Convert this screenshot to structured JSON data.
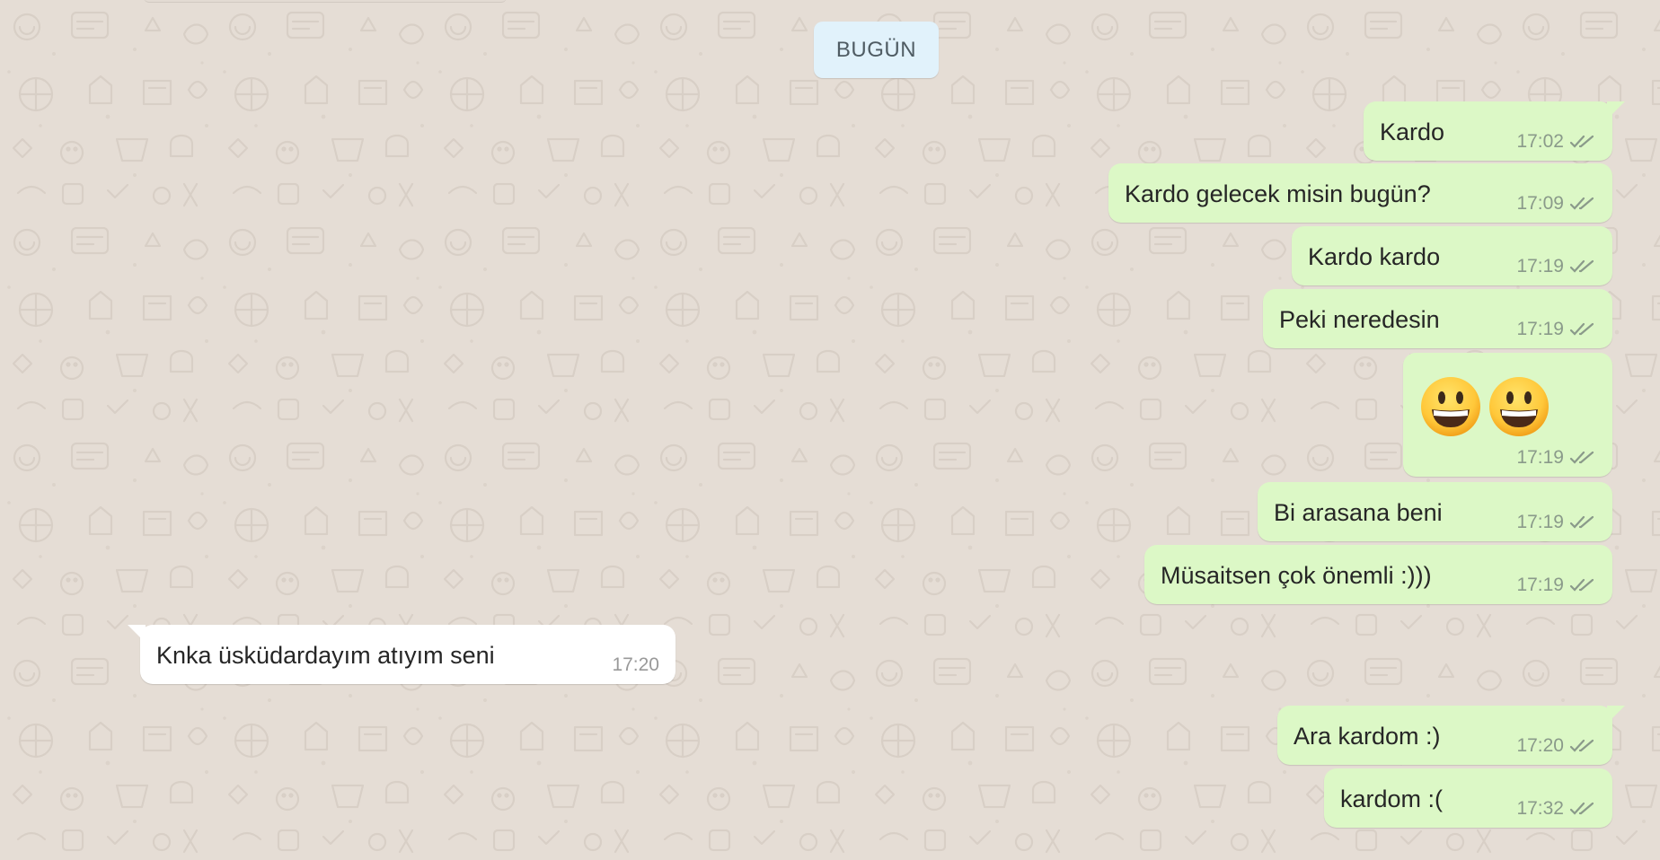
{
  "chat": {
    "date_divider": "BUGÜN",
    "messages": [
      {
        "direction": "out",
        "text": "Kardo",
        "time": "17:02",
        "status": "read-ticks-icon"
      },
      {
        "direction": "out",
        "text": "Kardo gelecek misin bugün?",
        "time": "17:09",
        "status": "read-ticks-icon"
      },
      {
        "direction": "out",
        "text": "Kardo kardo",
        "time": "17:19",
        "status": "read-ticks-icon"
      },
      {
        "direction": "out",
        "text": "Peki neredesin",
        "time": "17:19",
        "status": "read-ticks-icon"
      },
      {
        "direction": "out",
        "emoji": [
          "grinning-face-emoji",
          "grinning-face-emoji"
        ],
        "time": "17:19",
        "status": "read-ticks-icon"
      },
      {
        "direction": "out",
        "text": "Bi arasana beni",
        "time": "17:19",
        "status": "read-ticks-icon"
      },
      {
        "direction": "out",
        "text": "Müsaitsen çok önemli :)))",
        "time": "17:19",
        "status": "read-ticks-icon"
      },
      {
        "direction": "in",
        "text": "Knka üsküdardayım atıyım seni",
        "time": "17:20"
      },
      {
        "direction": "out",
        "text": "Ara kardom :)",
        "time": "17:20",
        "status": "read-ticks-icon"
      },
      {
        "direction": "out",
        "text": "kardom :(",
        "time": "17:32",
        "status": "read-ticks-icon"
      }
    ]
  },
  "colors": {
    "background": "#e5ddd5",
    "outgoing_bubble": "#dcf8c6",
    "incoming_bubble": "#ffffff",
    "date_chip": "#e1f2fb",
    "tick_gray": "#8a9a8a"
  }
}
